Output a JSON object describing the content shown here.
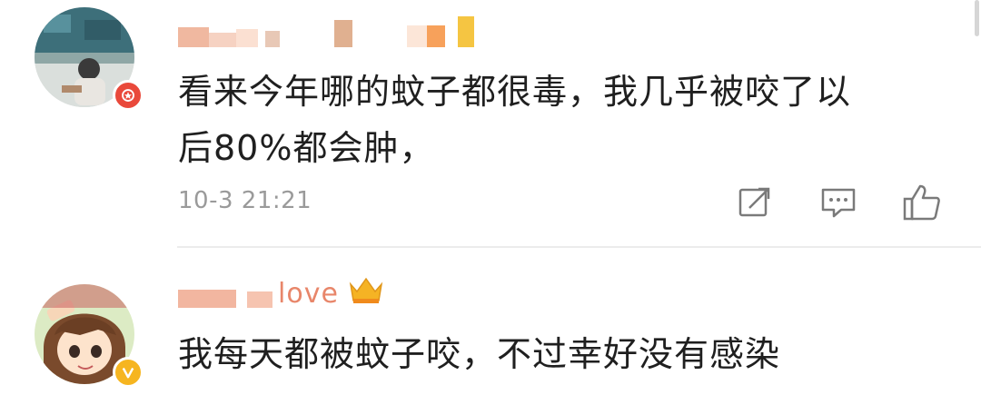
{
  "comments": [
    {
      "username_visible_fragment": "",
      "text_line1": "看来今年哪的蚊子都很毒，我几乎被咬了以",
      "text_line2": "后80%都会肿，",
      "timestamp": "10-3 21:21",
      "badge_icon": "red-star-badge-icon",
      "actions": [
        "share-icon",
        "reply-icon",
        "like-icon"
      ]
    },
    {
      "username_visible_fragment": "love",
      "text_line1": "我每天都被蚊子咬，不过幸好没有感染",
      "badge_icon": "gold-v-badge-icon",
      "crown_icon": "crown-icon"
    }
  ],
  "colors": {
    "text": "#1f1f1f",
    "meta": "#9a9a9a",
    "username": "#e8866a",
    "badge_red": "#e9493b",
    "badge_gold": "#f6b520",
    "divider": "#ececec"
  }
}
